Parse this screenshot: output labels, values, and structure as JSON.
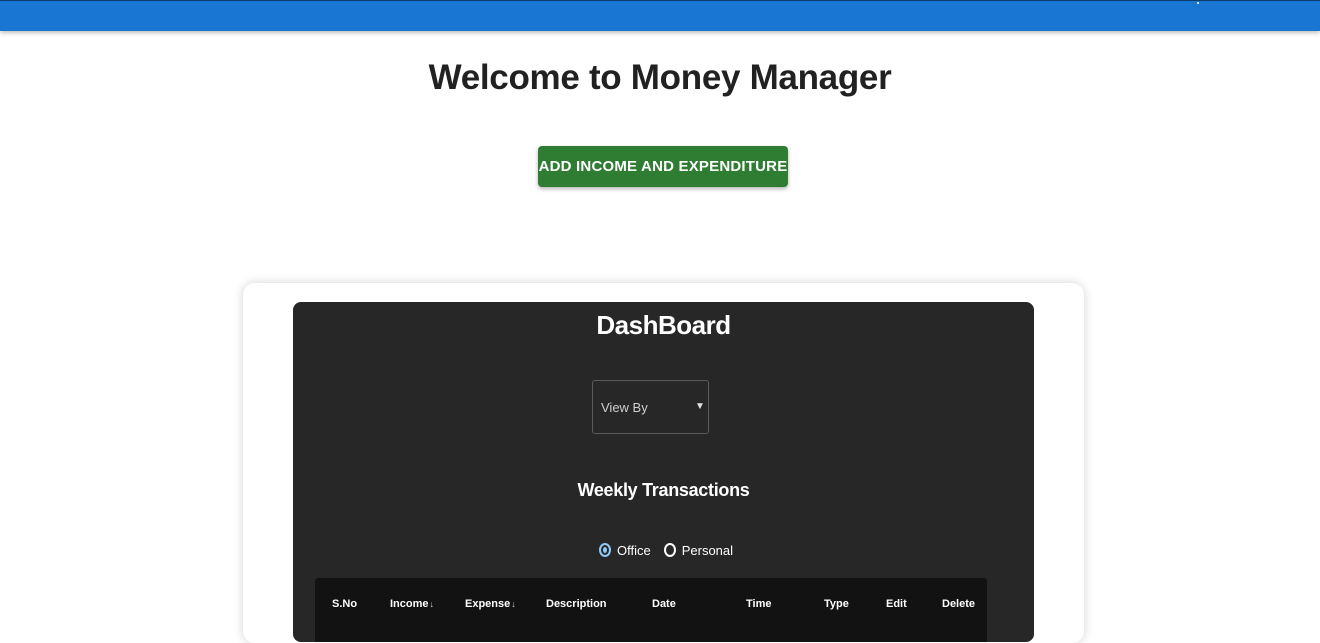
{
  "app": {
    "title": "Welcome to Money Manager",
    "add_button_label": "ADD INCOME AND EXPENDITURE",
    "brand_color": "#1976d2",
    "accent_color": "#2e7d32"
  },
  "dashboard": {
    "title": "DashBoard",
    "view_by": {
      "selected": "View By"
    },
    "section_title": "Weekly Transactions",
    "radios": [
      {
        "label": "Office",
        "checked": true
      },
      {
        "label": "Personal",
        "checked": false
      }
    ],
    "table": {
      "columns": [
        {
          "label": "S.No"
        },
        {
          "label": "Income",
          "sort": "↓"
        },
        {
          "label": "Expense",
          "sort": "↓"
        },
        {
          "label": "Description"
        },
        {
          "label": "Date"
        },
        {
          "label": "Time"
        },
        {
          "label": "Type"
        },
        {
          "label": "Edit"
        },
        {
          "label": "Delete"
        }
      ]
    }
  }
}
